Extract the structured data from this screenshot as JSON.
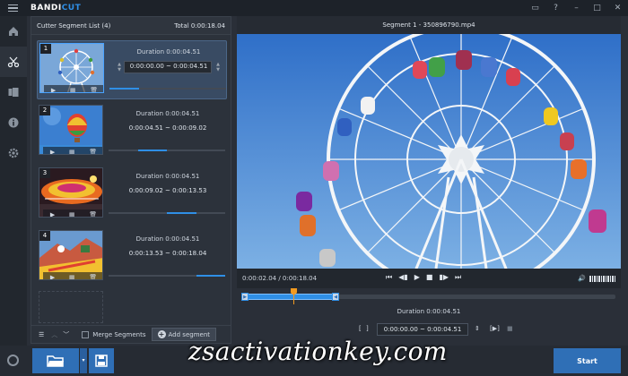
{
  "app": {
    "name_part1": "BANDI",
    "name_part2": "CUT"
  },
  "sidebar": {
    "items": [
      {
        "icon": "home-icon"
      },
      {
        "icon": "cutter-icon",
        "active": true
      },
      {
        "icon": "joiner-icon"
      },
      {
        "icon": "info-icon"
      },
      {
        "icon": "gear-icon"
      }
    ]
  },
  "segment_panel": {
    "title": "Cutter Segment List (4)",
    "total": "Total 0:00:18.04",
    "segments": [
      {
        "num": "1",
        "duration": "Duration 0:00:04.51",
        "range": "0:00:00.00 ~ 0:00:04.51",
        "progress": 0.25
      },
      {
        "num": "2",
        "duration": "Duration 0:00:04.51",
        "range": "0:00:04.51 ~ 0:00:09.02",
        "progress": 0.5
      },
      {
        "num": "3",
        "duration": "Duration 0:00:04.51",
        "range": "0:00:09.02 ~ 0:00:13.53",
        "progress": 0.75
      },
      {
        "num": "4",
        "duration": "Duration 0:00:04.51",
        "range": "0:00:13.53 ~ 0:00:18.04",
        "progress": 1.0
      }
    ],
    "merge_label": "Merge Segments",
    "add_label": "Add segment"
  },
  "video": {
    "title": "Segment 1 - 350896790.mp4",
    "timecode": "0:00:02.04 / 0:00:18.04",
    "duration": "Duration 0:00:04.51",
    "range": "0:00:00.00 ~ 0:00:04.51",
    "playhead": 0.113,
    "selection_end": 0.25
  },
  "bottom": {
    "start_label": "Start"
  },
  "watermark": "zsactivationkey.com",
  "colors": {
    "accent": "#2f8fe6",
    "button": "#2f6fb6"
  }
}
